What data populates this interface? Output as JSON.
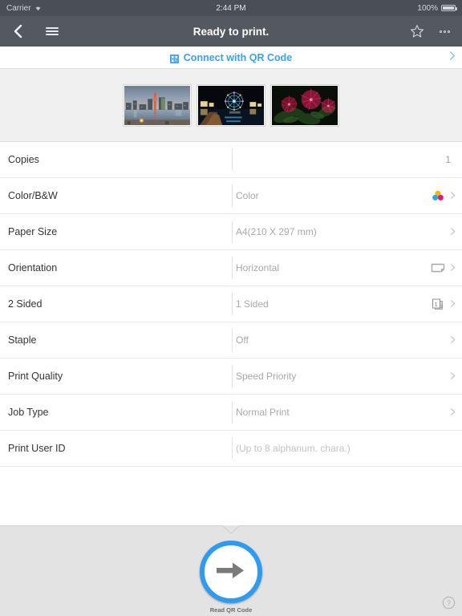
{
  "status_bar": {
    "carrier": "Carrier",
    "wifi_icon": "wifi-icon",
    "time": "2:44 PM",
    "battery_percent": "100%",
    "battery_icon": "battery-full-icon"
  },
  "nav_bar": {
    "back_icon": "back-chevron-icon",
    "menu_icon": "hamburger-menu-icon",
    "title": "Ready to print.",
    "favorite_icon": "star-outline-icon",
    "more_icon": "more-dots-icon"
  },
  "qr_bar": {
    "icon": "qr-code-icon",
    "label": "Connect with QR Code",
    "chevron_icon": "chevron-right-icon",
    "accent_color": "#3ba0f5"
  },
  "gallery": {
    "thumbnails": [
      {
        "name": "harbor-skyline-dusk",
        "alt": "Harbor city skyline at dusk with red tower"
      },
      {
        "name": "ferris-wheel-night",
        "alt": "Night waterfront with illuminated ferris wheel"
      },
      {
        "name": "red-powderpuff-flowers",
        "alt": "Red powder puff flowers with green leaves"
      }
    ]
  },
  "settings": {
    "rows": [
      {
        "label": "Copies",
        "value": "1",
        "value_style": "right",
        "icon": null,
        "chevron": false
      },
      {
        "label": "Color/B&W",
        "value": "Color",
        "value_style": "normal",
        "icon": "color-wheel-icon",
        "chevron": true
      },
      {
        "label": "Paper Size",
        "value": "A4(210 X 297 mm)",
        "value_style": "normal",
        "icon": null,
        "chevron": true
      },
      {
        "label": "Orientation",
        "value": "Horizontal",
        "value_style": "normal",
        "icon": "landscape-page-icon",
        "chevron": true
      },
      {
        "label": "2 Sided",
        "value": "1 Sided",
        "value_style": "normal",
        "icon": "two-sided-pages-icon",
        "chevron": true
      },
      {
        "label": "Staple",
        "value": "Off",
        "value_style": "normal",
        "icon": null,
        "chevron": true
      },
      {
        "label": "Print Quality",
        "value": "Speed Priority",
        "value_style": "normal",
        "icon": null,
        "chevron": true
      },
      {
        "label": "Job Type",
        "value": "Normal Print",
        "value_style": "normal",
        "icon": null,
        "chevron": true
      },
      {
        "label": "Print User ID",
        "value": "(Up to 8 alphanum. chara.)",
        "value_style": "faint",
        "icon": null,
        "chevron": false
      }
    ]
  },
  "footer": {
    "qr_button_label": "Read QR Code",
    "qr_button_icon": "arrow-right-icon",
    "ring_color": "#2f9bf0",
    "help_icon": "help-question-icon"
  }
}
